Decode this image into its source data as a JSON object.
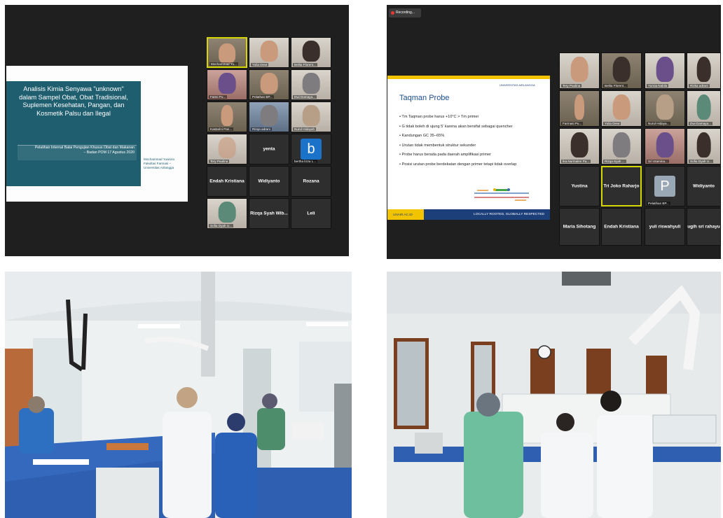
{
  "panel_top_left": {
    "slide": {
      "title_lines": [
        "Analisis Kimia Senyawa \"unknown\"",
        "dalam Sampel Obat, Obat Tradisional,",
        "Suplemen Kesehatan, Pangan, dan",
        "Kosmetik Palsu dan Ilegal"
      ],
      "subtitle_lines": [
        "Pelatihan Internal Balai Pengujian Khusus Obat dan Makanan",
        "– Badan POM 17 Agustus 2020"
      ],
      "author_lines": [
        "Mochammad Yuwono",
        "Fakultas Farmasi –",
        "Universitas Airlangga"
      ]
    },
    "participants": [
      "Mochammad Yu...",
      "Yulia Dewi",
      "Belita Florent...",
      "Fatmi Pu...",
      "Pelathan BP...",
      "Dwi Damaya...",
      "Kastarini Pan...",
      "Rizqa adrani",
      "Nurul Hidayah",
      "Tery Paulina",
      "yenta",
      "bertha lizza L...",
      "Endah Kristiana",
      "Widiyanto",
      "Rozana",
      "Sofia Dyah U...",
      "Rizqa Syah Wib...",
      "Leli"
    ],
    "avatar_letter": "b"
  },
  "panel_top_right": {
    "recording_label": "Recording...",
    "slide": {
      "logo_text": "UNIVERSITAS AIRLANGGA",
      "title": "Taqman Probe",
      "bullets": [
        "Tm Taqman probe harus +10°C > Tm primer",
        "G tidak boleh di ujung 5' karena akan bersifat sebagai quencher",
        "Kandungan GC 35–65%",
        "Urutan tidak membentuk struktur sekunder",
        "Probe harus berada pada daerah amplifikasi primer",
        "Posisi urutan probe berdekatan dengan primer tetapi tidak overlap"
      ],
      "footer_left": "UNAIR.AC.ID",
      "footer_right": "LOCALLY ROOTED, GLOBALLY RESPECTED"
    },
    "participants": [
      "Tery Paulina",
      "Belita Florent...",
      "Yurnia Nabila",
      "Rizka adrani",
      "Farmasi Pu...",
      "Yulia Dewi",
      "Nurul Hidaya...",
      "Dwi Damaya...",
      "Ika Nurmalen Pa...",
      "Rizqa Syah ...",
      "Sri Utamina...",
      "Sofia Dyah U...",
      "Yustina",
      "Tri Joko Raharjo",
      "Pelatihan BP...",
      "Widiyanto",
      "Maria Sihotang",
      "Endah Kristiana",
      "yuli riswahyuli",
      "ugih sri rahayu"
    ],
    "avatar_letter": "P"
  },
  "panel_bottom_left": {
    "type": "photo",
    "subject": "laboratory"
  },
  "panel_bottom_right": {
    "type": "photo",
    "subject": "laboratory"
  },
  "colors": {
    "slide_teal": "#1e5e6f",
    "zoom_bg": "#1f1f1f",
    "unair_blue": "#1c3f7a",
    "unair_yellow": "#f2c400",
    "lab_bench_blue": "#2f5fb0"
  }
}
